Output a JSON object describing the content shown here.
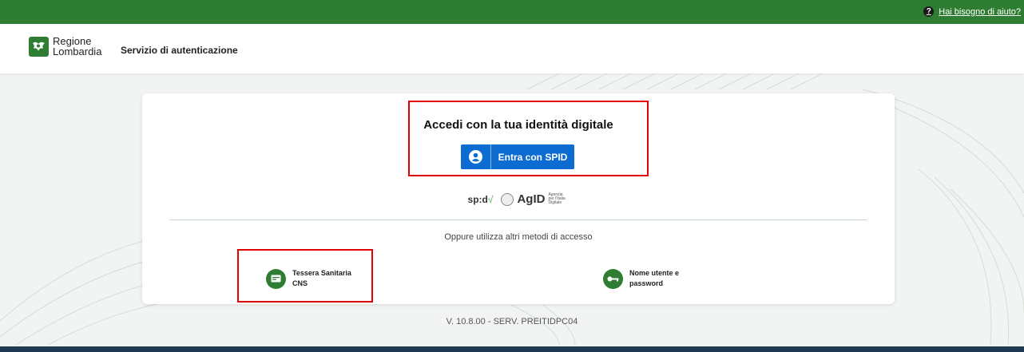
{
  "topbar": {
    "help_label": "Hai bisogno di aiuto?",
    "help_icon": "question-icon"
  },
  "header": {
    "logo_line1": "Regione",
    "logo_line2": "Lombardia",
    "service_title": "Servizio di autenticazione"
  },
  "card": {
    "title": "Accedi con la tua identità digitale",
    "spid_button_label": "Entra con SPID",
    "spid_logo_text": "sp:d",
    "agid_name": "AgID",
    "agid_sub": "Agenzia per l'Italia Digitale",
    "alt_methods_text": "Oppure utilizza altri metodi di accesso",
    "methods": [
      {
        "label_line1": "Tessera Sanitaria",
        "label_line2": "CNS",
        "icon": "card-icon"
      },
      {
        "label_line1": "Nome utente e",
        "label_line2": "password",
        "icon": "key-icon"
      }
    ]
  },
  "footer": {
    "version": "V. 10.8.00 - SERV. PREITIDPC04"
  },
  "colors": {
    "primary_green": "#2e7d32",
    "spid_blue": "#0c6cd1",
    "highlight_red": "#e30000"
  }
}
